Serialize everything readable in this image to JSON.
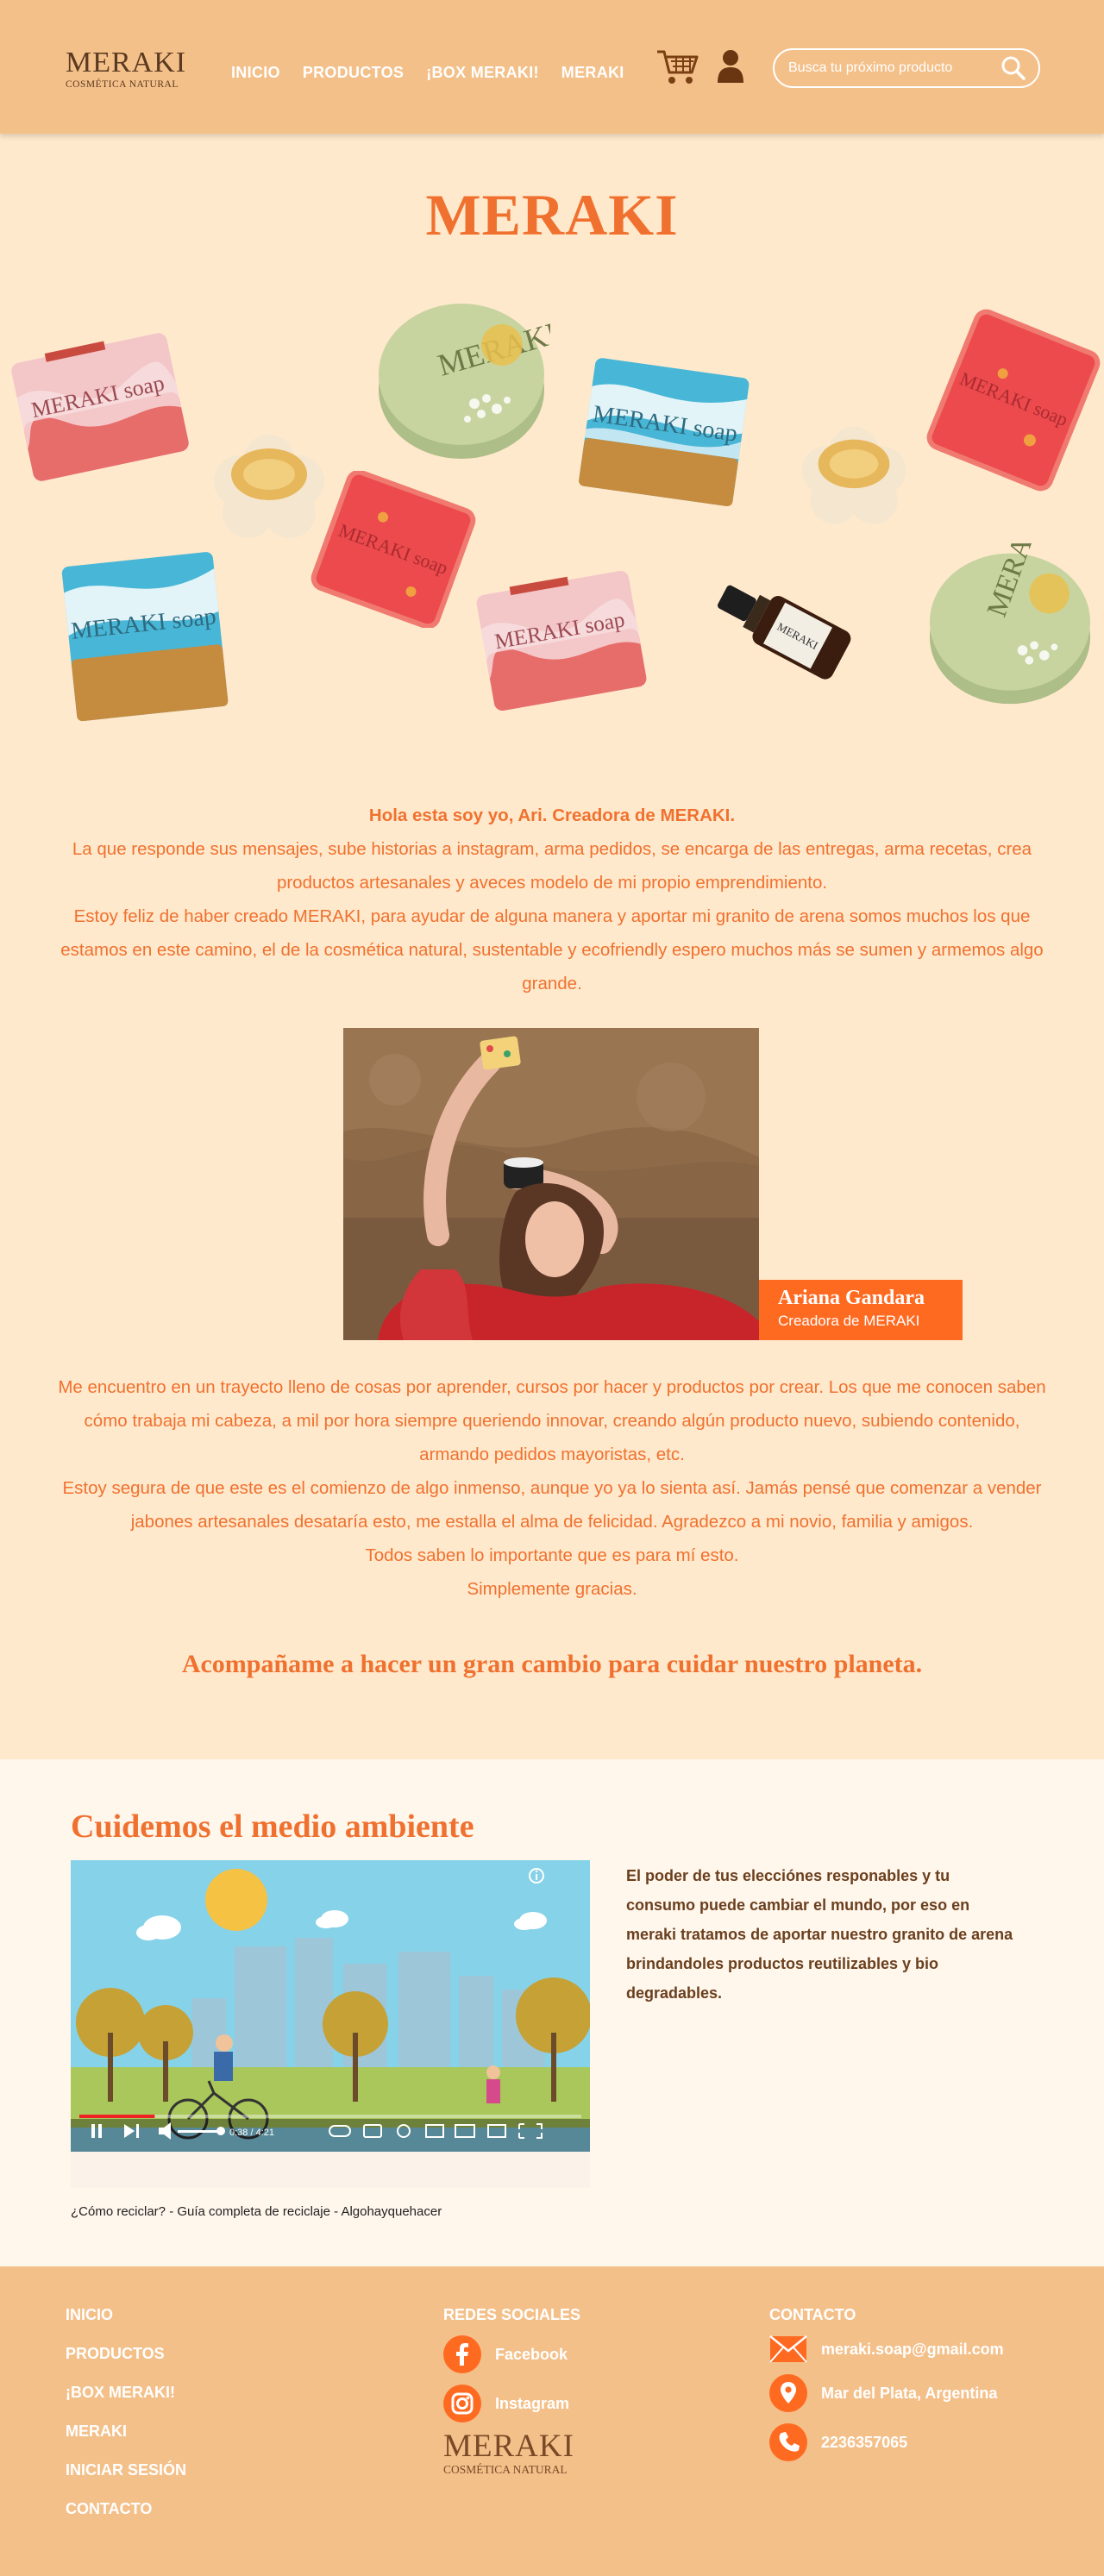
{
  "header": {
    "logo_main": "MERAKI",
    "logo_sub": "COSMÉTICA NATURAL",
    "nav": [
      "INICIO",
      "PRODUCTOS",
      "¡BOX MERAKI!",
      "MERAKI"
    ],
    "search_placeholder": "Busca tu próximo producto",
    "icons": [
      "cart-icon",
      "user-icon",
      "search-icon"
    ]
  },
  "hero": {
    "title": "MERAKI",
    "product_label": "MERAKI soap"
  },
  "intro": {
    "heading": "Hola esta soy yo, Ari. Creadora de MERAKI.",
    "p1": "La que responde sus mensajes, sube historias a instagram, arma pedidos, se encarga de las entregas, arma recetas, crea productos artesanales y aveces modelo de mi propio emprendimiento.",
    "p2": "Estoy feliz de haber creado MERAKI, para ayudar de alguna manera y aportar mi granito de arena  somos muchos los que estamos en este camino, el de la cosmética natural, sustentable y ecofriendly espero muchos más se sumen y armemos algo grande."
  },
  "photo": {
    "name": "Ariana Gandara",
    "role": "Creadora de MERAKI"
  },
  "story": {
    "p1": "Me encuentro en un trayecto lleno de cosas por aprender, cursos por hacer y productos por crear. Los que me conocen saben cómo trabaja mi cabeza, a mil por hora siempre queriendo innovar, creando algún producto nuevo, subiendo contenido, armando pedidos mayoristas, etc.",
    "p2": "Estoy segura de que este es el comienzo de algo inmenso, aunque yo ya lo sienta así. Jamás pensé que comenzar a vender jabones artesanales desataría esto, me estalla el alma de felicidad.  Agradezco a mi novio, familia y amigos.",
    "p3": "Todos saben lo importante que es para mí esto.",
    "p4": "Simplemente gracias.",
    "cta": "Acompañame a hacer un gran cambio para cuidar nuestro planeta."
  },
  "environment": {
    "title": "Cuidemos el medio ambiente",
    "video_time": "0:38 / 4:21",
    "video_progress": 0.15,
    "video_caption": "¿Cómo reciclar? - Guía completa de reciclaje - Algohayquehacer",
    "text": "El poder de tus elecciónes responables y tu consumo puede cambiar el mundo, por eso en meraki tratamos de aportar nuestro granito de arena brindandoles productos reutilizables y bio degradables."
  },
  "footer": {
    "links": [
      "INICIO",
      "PRODUCTOS",
      "¡BOX MERAKI!",
      "MERAKI",
      "INICIAR SESIÓN",
      "CONTACTO"
    ],
    "social_heading": "REDES SOCIALES",
    "social": [
      "Facebook",
      "Instagram"
    ],
    "contact_heading": "CONTACTO",
    "email": "meraki.soap@gmail.com",
    "location": "Mar del Plata, Argentina",
    "phone": "2236357065",
    "logo_main": "MERAKI",
    "logo_sub": "COSMÉTICA NATURAL"
  },
  "colors": {
    "header": "#f4c08a",
    "background": "#ffe9cc",
    "accent": "#f0712f",
    "caption": "#ff6a21",
    "brown": "#6a3f1d"
  }
}
